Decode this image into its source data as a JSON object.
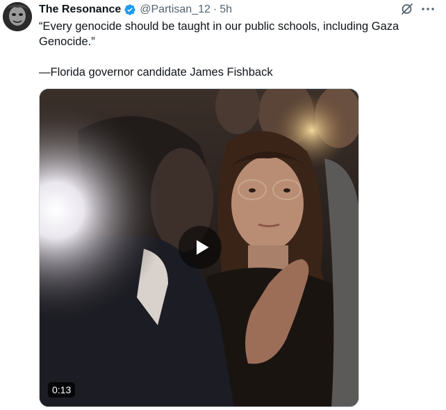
{
  "tweet": {
    "author_name": "The Resonance",
    "handle": "@Partisan_12",
    "separator": "·",
    "time": "5h",
    "text_line1": "“Every genocide should be taught in our public schools, including Gaza Genocide.”",
    "text_line2": "—Florida governor candidate James Fishback"
  },
  "media": {
    "duration": "0:13",
    "play_icon": "play-icon"
  },
  "icons": {
    "verified": "verified-badge-icon",
    "grok": "grok-icon",
    "more": "more-options-icon"
  },
  "colors": {
    "verified": "#1d9bf0",
    "secondary_text": "#536471",
    "primary_text": "#0f1419"
  }
}
